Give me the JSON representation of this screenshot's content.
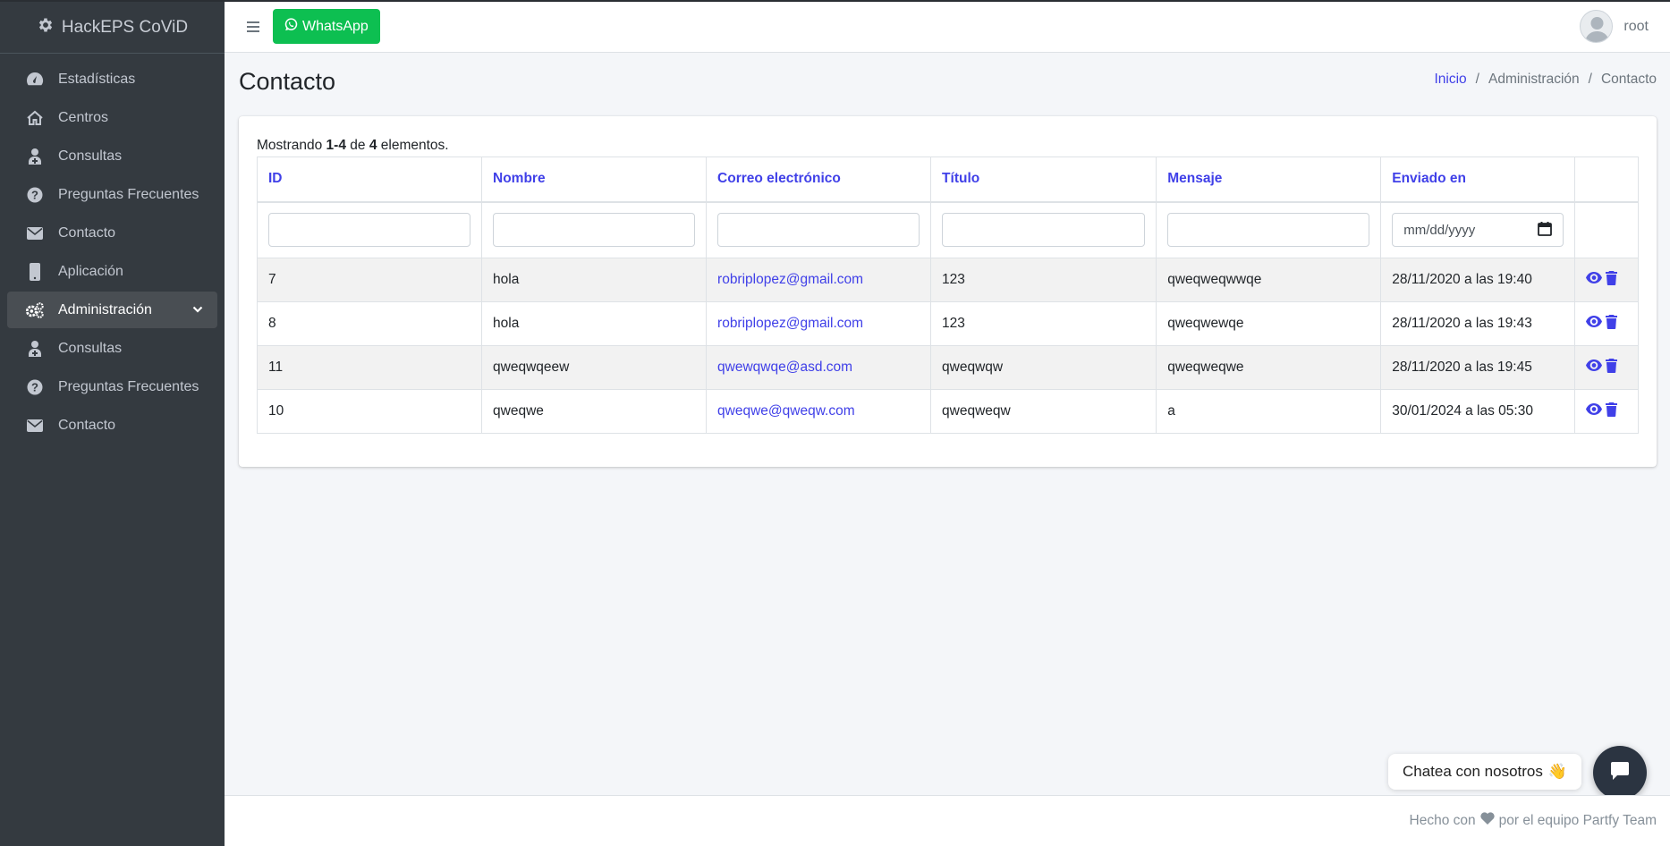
{
  "brand": {
    "name": "HackEPS CoViD",
    "icon": "gear-icon"
  },
  "sidebar": {
    "items": [
      {
        "label": "Estadísticas",
        "icon": "dashboard-icon"
      },
      {
        "label": "Centros",
        "icon": "home-icon"
      },
      {
        "label": "Consultas",
        "icon": "user-doctor-icon"
      },
      {
        "label": "Preguntas Frecuentes",
        "icon": "question-circle-icon"
      },
      {
        "label": "Contacto",
        "icon": "envelope-icon"
      },
      {
        "label": "Aplicación",
        "icon": "mobile-icon"
      }
    ],
    "admin": {
      "label": "Administración",
      "icon": "gears-icon",
      "expanded": true
    },
    "admin_items": [
      {
        "label": "Consultas",
        "icon": "user-doctor-icon"
      },
      {
        "label": "Preguntas Frecuentes",
        "icon": "question-circle-icon"
      },
      {
        "label": "Contacto",
        "icon": "envelope-icon"
      }
    ]
  },
  "topbar": {
    "whatsapp_label": "WhatsApp",
    "user_name": "root"
  },
  "page": {
    "title": "Contacto"
  },
  "breadcrumb": {
    "home": "Inicio",
    "admin": "Administración",
    "current": "Contacto",
    "separator": "/"
  },
  "summary": {
    "prefix": "Mostrando",
    "range": "1-4",
    "of": "de",
    "total": "4",
    "suffix": "elementos."
  },
  "table": {
    "headers": [
      "ID",
      "Nombre",
      "Correo electrónico",
      "Título",
      "Mensaje",
      "Enviado en"
    ],
    "date_placeholder": "mm/dd/yyyy",
    "rows": [
      {
        "id": "7",
        "nombre": "hola",
        "correo": "robriplopez@gmail.com",
        "titulo": "123",
        "mensaje": "qweqweqwwqe",
        "enviado": "28/11/2020 a las 19:40"
      },
      {
        "id": "8",
        "nombre": "hola",
        "correo": "robriplopez@gmail.com",
        "titulo": "123",
        "mensaje": "qweqwewqe",
        "enviado": "28/11/2020 a las 19:43"
      },
      {
        "id": "11",
        "nombre": "qweqwqeew",
        "correo": "qwewqwqe@asd.com",
        "titulo": "qweqwqw",
        "mensaje": "qweqweqwe",
        "enviado": "28/11/2020 a las 19:45"
      },
      {
        "id": "10",
        "nombre": "qweqwe",
        "correo": "qweqwe@qweqw.com",
        "titulo": "qweqweqw",
        "mensaje": "a",
        "enviado": "30/01/2024 a las 05:30"
      }
    ]
  },
  "footer": {
    "before": "Hecho con",
    "after": "por el equipo Partfy Team"
  },
  "chat": {
    "label": "Chatea con nosotros",
    "emoji": "👋"
  },
  "colors": {
    "sidebar_bg": "#343a40",
    "accent": "#4040e8",
    "whatsapp": "#0dbf51",
    "chat_button": "#2b3441"
  }
}
